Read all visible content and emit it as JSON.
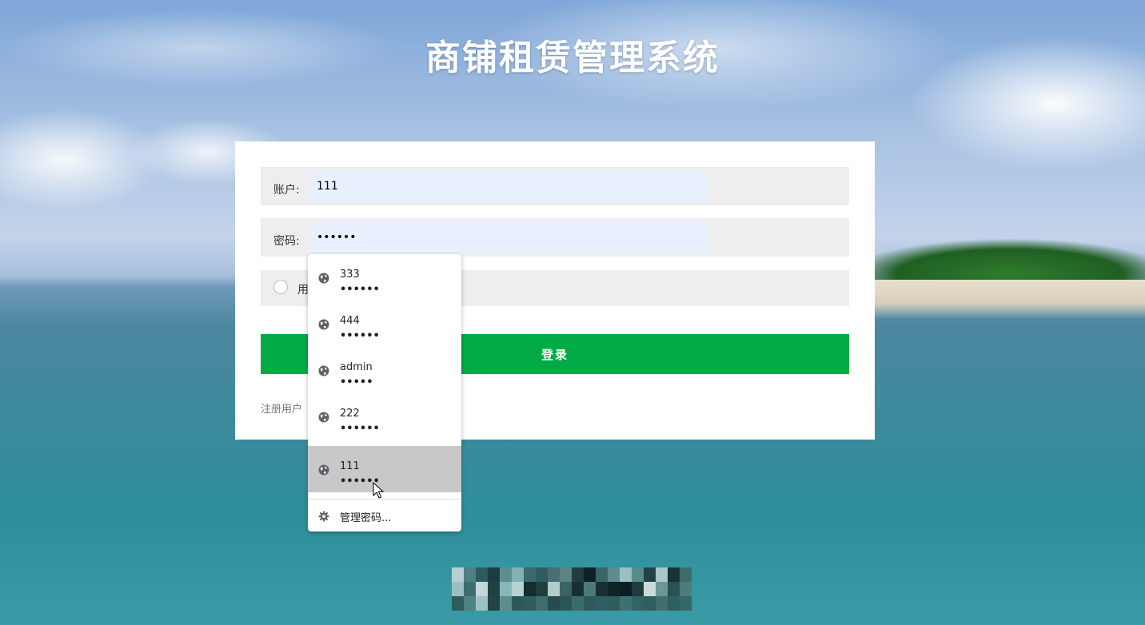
{
  "page": {
    "title": "商铺租赁管理系统"
  },
  "form": {
    "account_label": "账户:",
    "account_value": "111",
    "password_label": "密码:",
    "password_value": "••••••",
    "role_label": "用",
    "login_label": "登录",
    "register_label": "注册用户"
  },
  "autofill": {
    "items": [
      {
        "username": "333",
        "password": "••••••",
        "icon": "globe-icon"
      },
      {
        "username": "444",
        "password": "••••••",
        "icon": "globe-icon"
      },
      {
        "username": "admin",
        "password": "•••••",
        "icon": "globe-icon"
      },
      {
        "username": "222",
        "password": "••••••",
        "icon": "globe-icon"
      },
      {
        "username": "111",
        "password": "••••••",
        "icon": "globe-icon"
      }
    ],
    "selected_index": 4,
    "manage_label": "管理密码...",
    "manage_icon": "gear-icon"
  },
  "colors": {
    "login_button": "#00ab45",
    "input_autofill_bg": "#e8f0fe",
    "row_bg": "#eeeeee",
    "dropdown_selected": "#c8c8c8"
  }
}
